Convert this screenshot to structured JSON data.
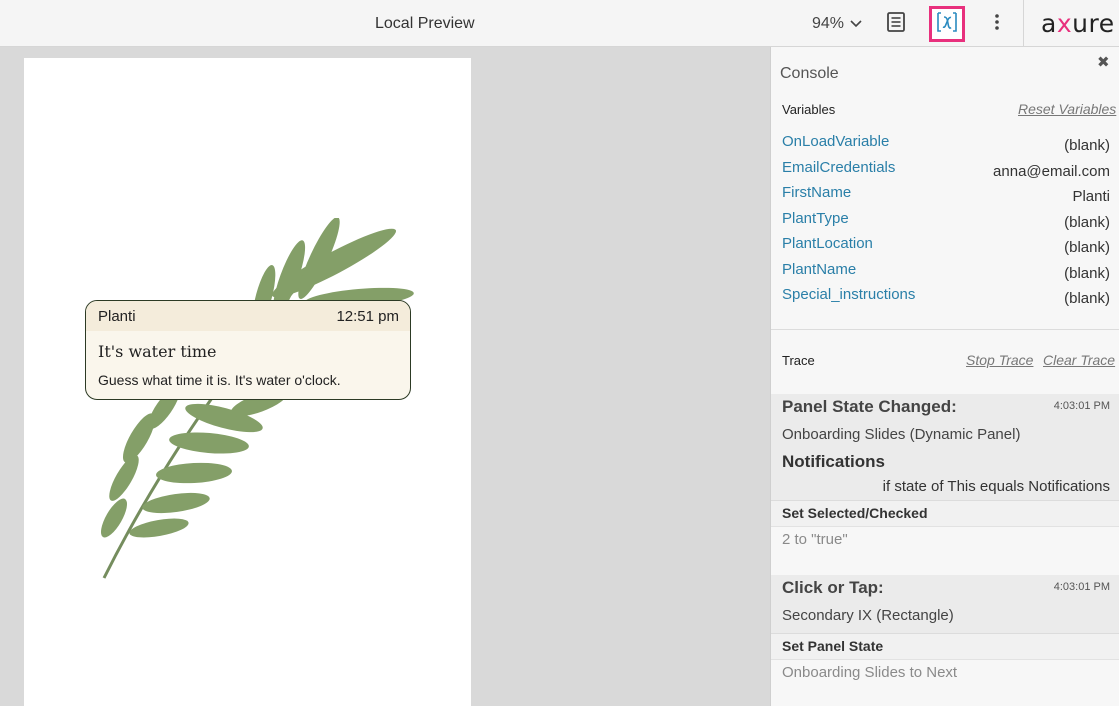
{
  "topbar": {
    "title": "Local Preview",
    "zoom": "94%",
    "logo_part1": "a",
    "logo_x": "x",
    "logo_part2": "ure"
  },
  "notification": {
    "app_name": "Planti",
    "time": "12:51 pm",
    "title": "It's water time",
    "body": "Guess what time it is. It's water o'clock."
  },
  "console": {
    "title": "Console",
    "close_glyph": "✖",
    "variables_label": "Variables",
    "reset_link": "Reset Variables",
    "variables": [
      {
        "name": "OnLoadVariable",
        "value": "(blank)"
      },
      {
        "name": "EmailCredentials",
        "value": "anna@email.com"
      },
      {
        "name": "FirstName",
        "value": "Planti"
      },
      {
        "name": "PlantType",
        "value": "(blank)"
      },
      {
        "name": "PlantLocation",
        "value": "(blank)"
      },
      {
        "name": "PlantName",
        "value": "(blank)"
      },
      {
        "name": "Special_instructions",
        "value": "(blank)"
      }
    ],
    "trace_label": "Trace",
    "stop_trace": "Stop Trace",
    "clear_trace": "Clear Trace",
    "trace": [
      {
        "event": "Panel State Changed:",
        "time": "4:03:01 PM",
        "source": "Onboarding Slides (Dynamic Panel)",
        "case": "Notifications",
        "condition": "if state of This equals Notifications",
        "action": "Set Selected/Checked",
        "detail": "2 to \"true\""
      },
      {
        "event": "Click or Tap:",
        "time": "4:03:01 PM",
        "source": "Secondary IX (Rectangle)",
        "action": "Set Panel State",
        "detail": "Onboarding Slides to Next"
      }
    ]
  },
  "icons": {
    "notes": "document-icon",
    "variables": "variable-x-icon",
    "more": "more-vertical-icon",
    "zoom_chevron": "chevron-down-icon",
    "close": "close-icon"
  },
  "colors": {
    "accent": "#e8307d",
    "var_blue": "#2a7fa8"
  }
}
